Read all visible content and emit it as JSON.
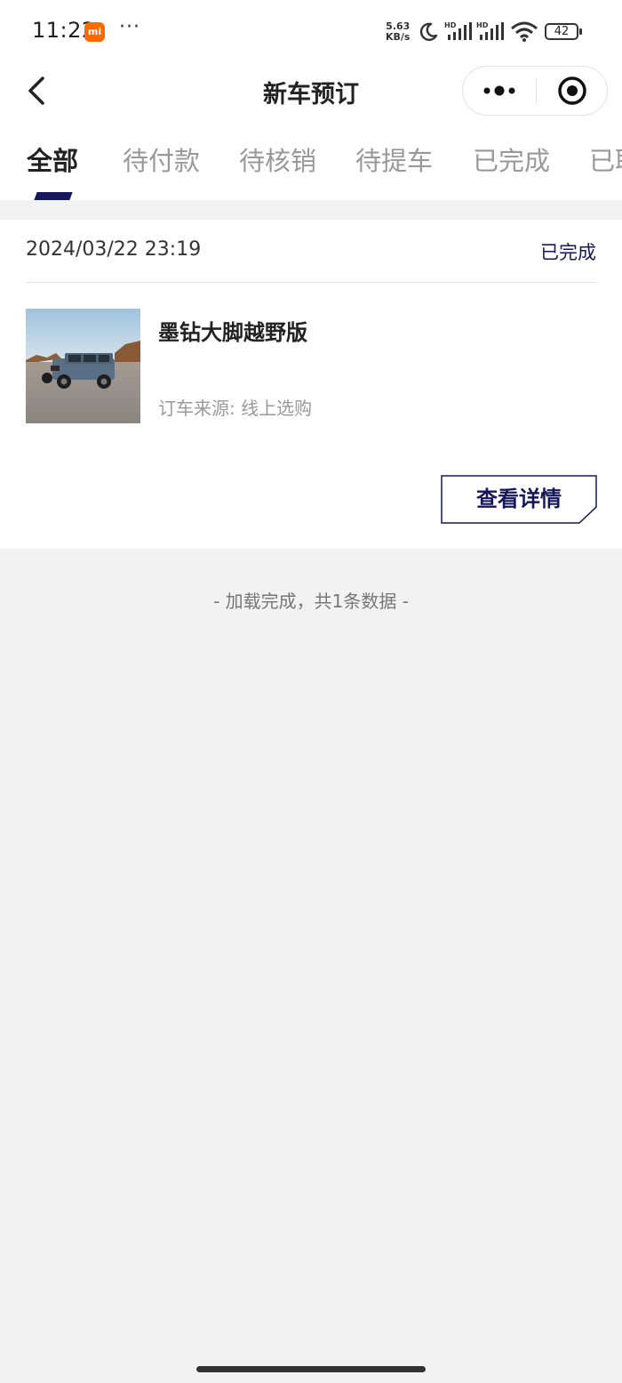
{
  "status_bar": {
    "time": "11:22",
    "mi_badge": "mi",
    "dots": "···",
    "net_speed_value": "5.63",
    "net_speed_unit": "KB/s",
    "battery": "42",
    "signal_label": "HD"
  },
  "nav": {
    "title": "新车预订"
  },
  "tabs": [
    {
      "label": "全部",
      "active": true
    },
    {
      "label": "待付款",
      "active": false
    },
    {
      "label": "待核销",
      "active": false
    },
    {
      "label": "待提车",
      "active": false
    },
    {
      "label": "已完成",
      "active": false
    },
    {
      "label": "已取",
      "active": false
    }
  ],
  "order": {
    "date": "2024/03/22 23:19",
    "status": "已完成",
    "product_name": "墨钻大脚越野版",
    "source": "订车来源: 线上选购",
    "details_button": "查看详情"
  },
  "footer": {
    "load_complete": "- 加载完成，共1条数据 -"
  },
  "colors": {
    "accent": "#15175a",
    "background": "#f2f2f2",
    "mi_orange": "#ff6900"
  }
}
